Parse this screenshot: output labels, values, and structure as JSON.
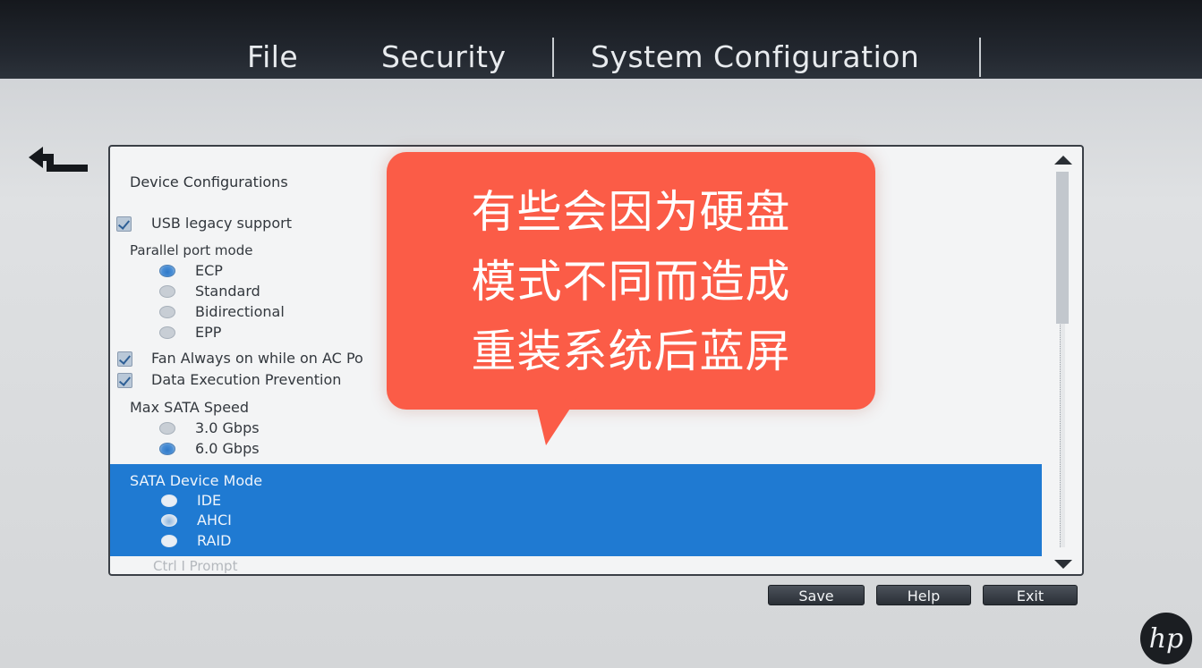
{
  "menubar": {
    "items": [
      "File",
      "Security",
      "System Configuration"
    ]
  },
  "panel": {
    "section_title": "Device Configurations",
    "usb_legacy": "USB legacy support",
    "parallel_label": "Parallel port mode",
    "parallel_options": [
      "ECP",
      "Standard",
      "Bidirectional",
      "EPP"
    ],
    "fan_label": "Fan Always on while on AC Po",
    "dep_label": "Data Execution Prevention",
    "sata_speed_label": "Max SATA Speed",
    "sata_speed_options": [
      "3.0 Gbps",
      "6.0 Gbps"
    ],
    "sata_mode_label": "SATA Device Mode",
    "sata_mode_options": [
      "IDE",
      "AHCI",
      "RAID"
    ],
    "ctrl_prompt": "Ctrl I Prompt"
  },
  "buttons": {
    "save": "Save",
    "help": "Help",
    "exit": "Exit"
  },
  "callout": {
    "line1": "有些会因为硬盘",
    "line2": "模式不同而造成",
    "line3": "重装系统后蓝屏"
  },
  "colors": {
    "callout": "#fb5c47",
    "selection": "#1f7ad2",
    "menubar": "#1b1f25"
  }
}
